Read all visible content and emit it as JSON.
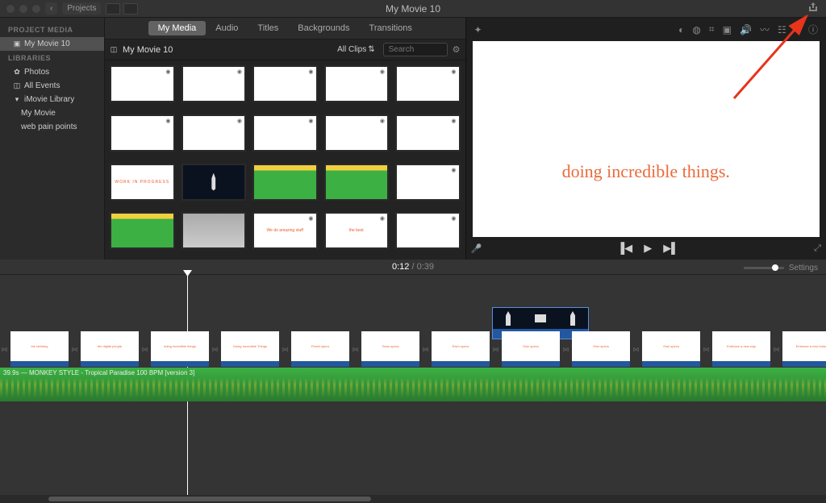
{
  "titlebar": {
    "left_label": "Projects",
    "title": "My Movie 10"
  },
  "sidebar": {
    "hdr1": "PROJECT MEDIA",
    "proj_item": "My Movie 10",
    "hdr2": "LIBRARIES",
    "photos": "Photos",
    "all_events": "All Events",
    "library_root": "iMovie Library",
    "lib_item1": "My Movie",
    "lib_item2": "web pain points"
  },
  "tabs": {
    "media": "My Media",
    "audio": "Audio",
    "titles": "Titles",
    "backgrounds": "Backgrounds",
    "transitions": "Transitions"
  },
  "browser_bar": {
    "current": "My Movie 10",
    "allclips": "All Clips",
    "search_ph": "Search"
  },
  "thumbs": {
    "t1": "",
    "t2": "",
    "t3": "",
    "t4": "",
    "t5": "",
    "t6": "",
    "t7": "",
    "t8": "",
    "t9": "",
    "t10": "",
    "t11": "WORK IN PROGRESS",
    "t12_rocket": true,
    "t13": "",
    "t14": "",
    "t15": "",
    "t16_green": true,
    "t17_cloudy": true,
    "t18": "We do amazing stuff",
    "t19": "the best",
    "t20": ""
  },
  "preview": {
    "text": "doing incredible things."
  },
  "timeline": {
    "current": "0:12",
    "total": "0:39",
    "settings": "Settings",
    "audio_label": "39.9s — MONKEY STYLE - Tropical Paradise 100 BPM [version 3]",
    "clips": [
      "",
      "the birthday",
      "",
      "the digital people",
      "",
      "doing incredible things",
      "",
      "Doing Incredible Things",
      "",
      "Finest specs",
      "",
      "Team specs",
      "",
      "Each specs",
      "",
      "Own specs",
      "",
      "Own specs",
      "",
      "Own specs",
      "",
      "Embrace a new way",
      "",
      "Embrace a new today",
      ""
    ]
  }
}
